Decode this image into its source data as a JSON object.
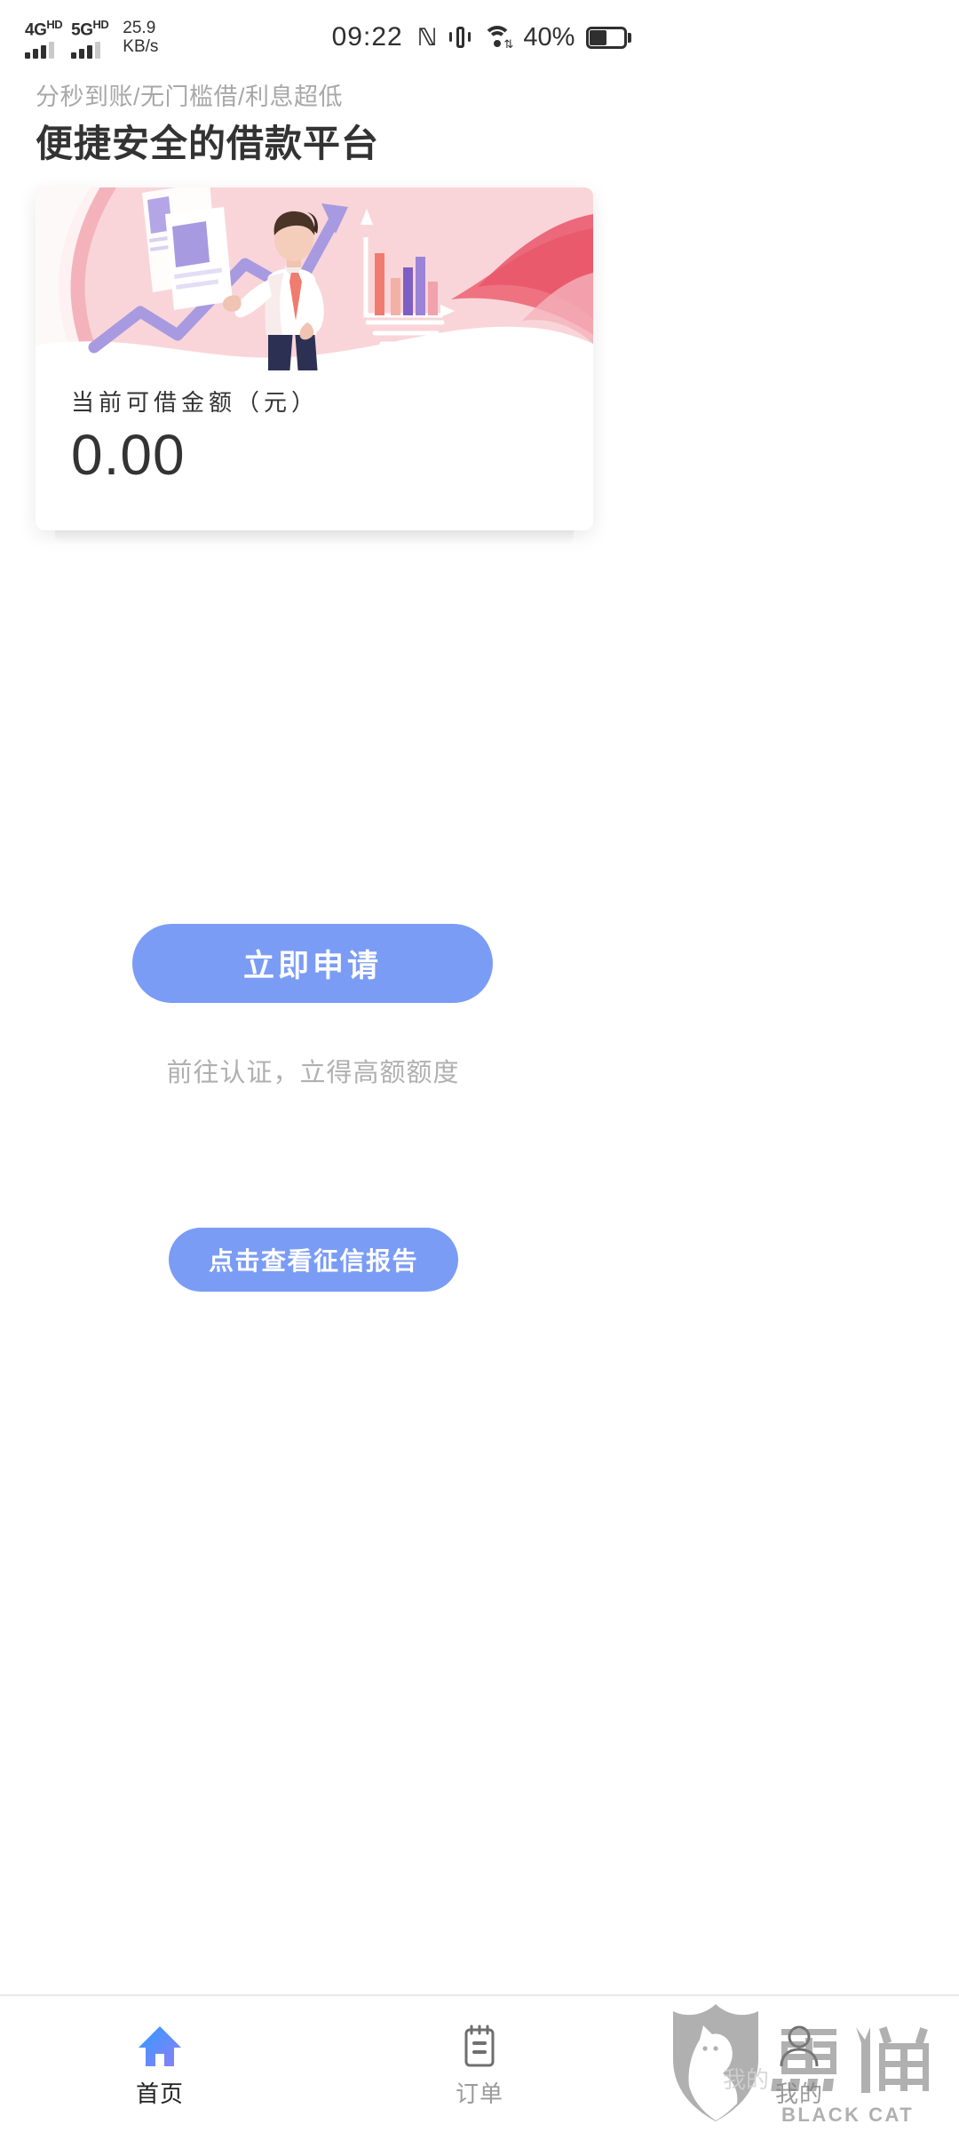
{
  "status_bar": {
    "sim1_label": "4G",
    "sim1_sup": "HD",
    "sim2_label": "5G",
    "sim2_sup": "HD",
    "net_speed_value": "25.9",
    "net_speed_unit": "KB/s",
    "clock": "09:22",
    "nfc_icon": "nfc-icon",
    "vibrate_icon": "vibrate-icon",
    "wifi_icon": "wifi-icon",
    "battery_percent": "40%",
    "battery_icon": "battery-icon"
  },
  "header": {
    "subtitle": "分秒到账/无门槛借/利息超低",
    "title": "便捷安全的借款平台"
  },
  "balance_card": {
    "illustration_name": "businessman-growth-chart-illustration",
    "label": "当前可借金额（元）",
    "amount": "0.00"
  },
  "actions": {
    "apply_label": "立即申请",
    "apply_hint": "前往认证，立得高额额度",
    "credit_report_label": "点击查看征信报告"
  },
  "bottom_nav": {
    "items": [
      {
        "label": "首页",
        "icon": "home-icon",
        "active": true
      },
      {
        "label": "订单",
        "icon": "clipboard-icon",
        "active": false
      },
      {
        "label": "我的",
        "icon": "person-icon",
        "active": false
      }
    ]
  },
  "watermark": {
    "title_cn": "黑猫",
    "title_en": "BLACK CAT",
    "logo_name": "black-cat-shield-logo"
  },
  "colors": {
    "accent_blue": "#7b9cf5",
    "text_dark": "#333333",
    "text_muted": "#a8a8a8",
    "card_pink": "#f9d7da"
  }
}
